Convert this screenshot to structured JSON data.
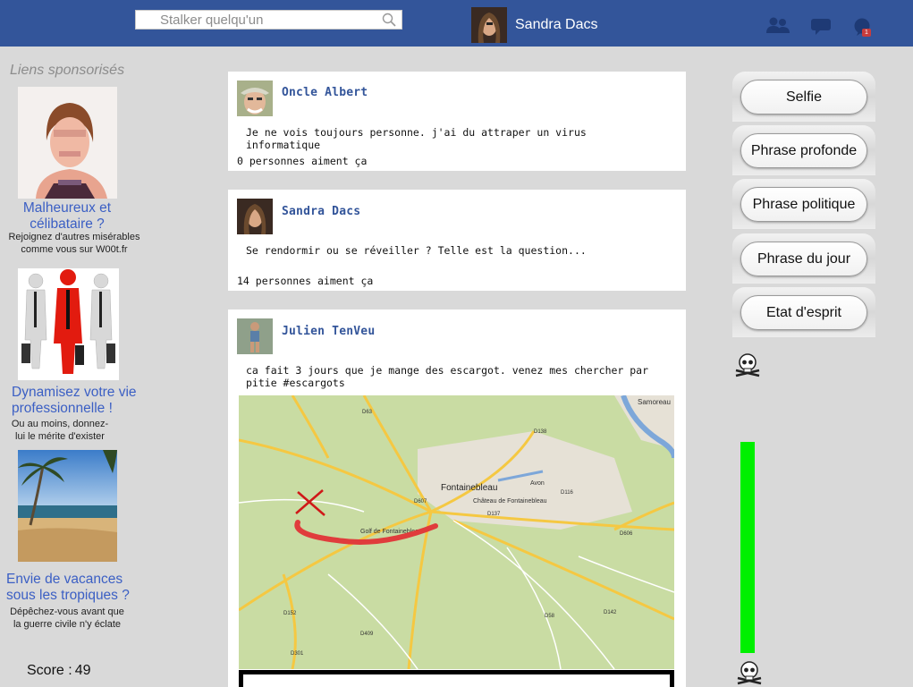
{
  "header": {
    "search_placeholder": "Stalker quelqu'un",
    "user_name": "Sandra Dacs",
    "notification_count": "1",
    "icons": [
      "friends-icon",
      "messages-icon",
      "notifications-icon"
    ],
    "bar_color": "#33559a"
  },
  "sidebar": {
    "title": "Liens sponsorisés",
    "ads": [
      {
        "title": "Malheureux et célibataire ?",
        "subtitle": "Rejoignez d'autres misérables comme vous sur W00t.fr"
      },
      {
        "title": "Dynamisez votre vie professionnelle !",
        "subtitle": "Ou au moins, donnez-lui le mérite d'exister"
      },
      {
        "title": "Envie de vacances sous les tropiques ?",
        "subtitle": "Dépêchez-vous avant que la guerre civile n'y éclate"
      }
    ],
    "score_label": "Score :",
    "score_value": "49"
  },
  "posts": [
    {
      "author": "Oncle Albert",
      "text": "Je ne vois toujours personne. j'ai du attraper un virus informatique",
      "likes": "0 personnes aiment ça"
    },
    {
      "author": "Sandra Dacs",
      "text": "Se rendormir ou se réveiller ? Telle est la question...",
      "likes": "14 personnes aiment ça"
    },
    {
      "author": "Julien TenVeu",
      "text": "ca fait 3 jours que je mange des escargot. venez mes chercher par pitie #escargots",
      "map": {
        "town": "Fontainebleau",
        "chateau": "Château de Fontainebleau",
        "golf": "Golf de Fontainebleau",
        "places": [
          "Samoreau",
          "Avon"
        ],
        "roads": [
          "D607",
          "D137",
          "D152",
          "D409",
          "D58",
          "D606",
          "D116",
          "D142",
          "D301",
          "D63",
          "D138"
        ]
      }
    }
  ],
  "actions": {
    "buttons": [
      "Selfie",
      "Phrase profonde",
      "Phrase politique",
      "Phrase du jour",
      "Etat d'esprit"
    ]
  },
  "gauge": {
    "level_fraction": 0.76,
    "color": "#00f000",
    "icon": "skull-icon"
  }
}
